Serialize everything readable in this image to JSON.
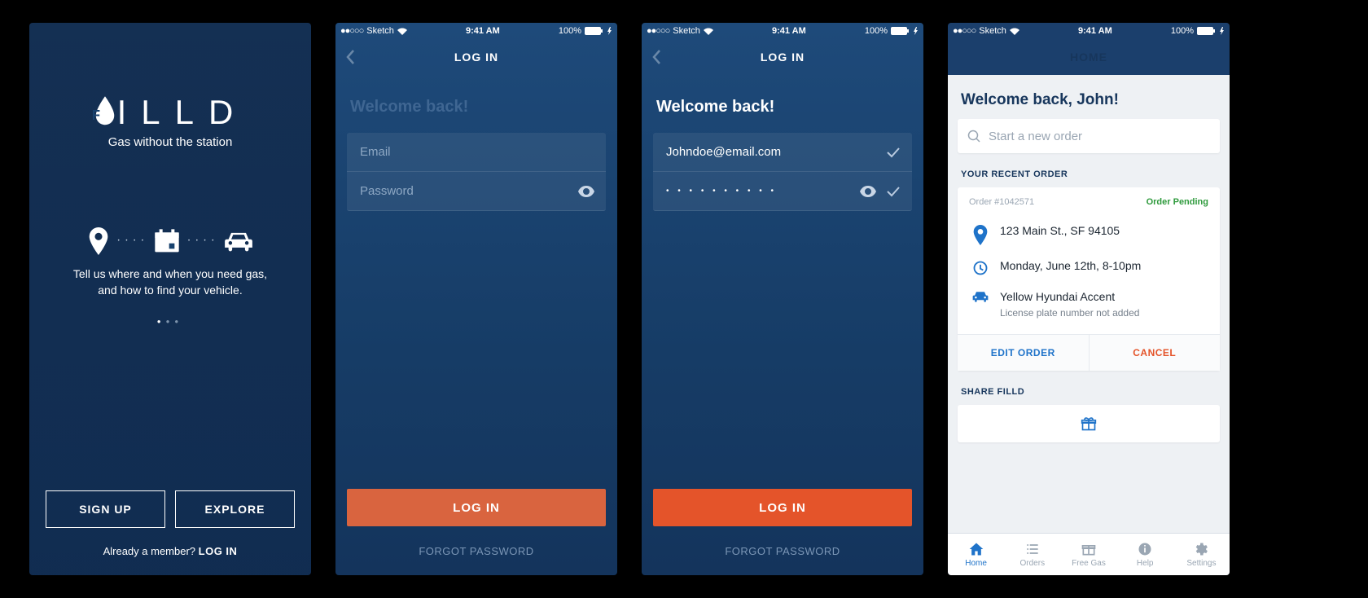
{
  "statusbar": {
    "carrier": "Sketch",
    "time": "9:41 AM",
    "battery": "100%"
  },
  "screen1": {
    "brand": "ILLD",
    "tagline": "Gas without the station",
    "onboard_text_l1": "Tell us where and when you need gas,",
    "onboard_text_l2": "and how to find your vehicle.",
    "signup": "SIGN UP",
    "explore": "EXPLORE",
    "already_prefix": "Already a member? ",
    "already_login": "LOG IN"
  },
  "screen2": {
    "nav_title": "LOG IN",
    "welcome": "Welcome back!",
    "email_placeholder": "Email",
    "password_placeholder": "Password",
    "login_button": "LOG IN",
    "forgot": "FORGOT PASSWORD"
  },
  "screen3": {
    "nav_title": "LOG IN",
    "welcome": "Welcome back!",
    "email_value": "Johndoe@email.com",
    "password_masked": "• • • • • • • • • •",
    "login_button": "LOG IN",
    "forgot": "FORGOT PASSWORD"
  },
  "screen4": {
    "nav_title": "HOME",
    "welcome": "Welcome back, John!",
    "search_placeholder": "Start a new order",
    "section_recent": "YOUR RECENT ORDER",
    "order": {
      "number": "Order #1042571",
      "status": "Order Pending",
      "address": "123 Main St., SF 94105",
      "time": "Monday, June 12th, 8-10pm",
      "car": "Yellow Hyundai Accent",
      "car_sub": "License plate number not added",
      "edit": "EDIT ORDER",
      "cancel": "CANCEL"
    },
    "section_share": "SHARE FILLD",
    "tabs": {
      "home": "Home",
      "orders": "Orders",
      "freegas": "Free Gas",
      "help": "Help",
      "settings": "Settings"
    }
  }
}
